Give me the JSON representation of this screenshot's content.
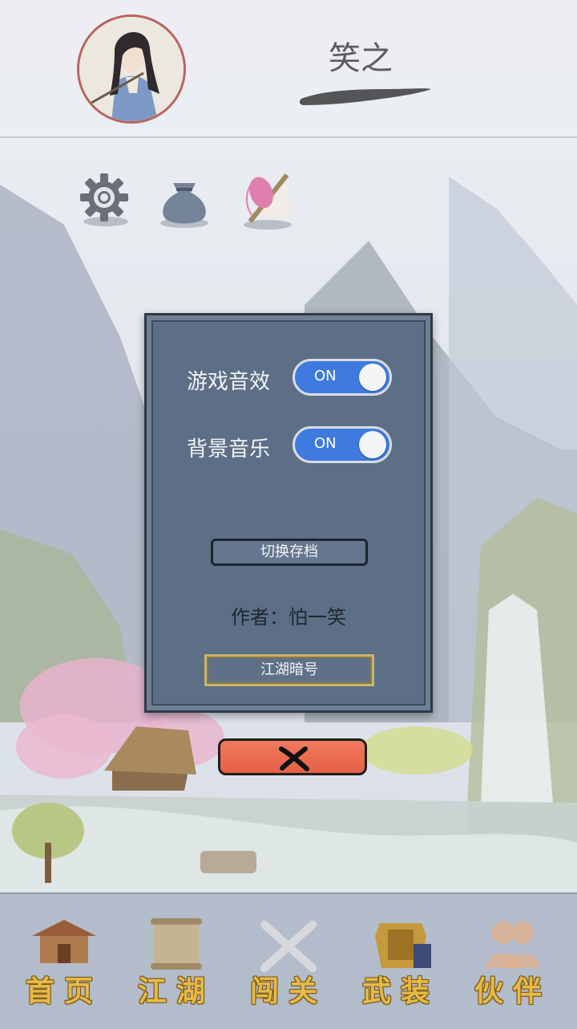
{
  "profile": {
    "name": "笑之"
  },
  "toolbar": {
    "settings_icon": "gear-icon",
    "bag_icon": "pouch-icon",
    "token_icon": "token-tag-icon"
  },
  "settings": {
    "sound_label": "游戏音效",
    "sound_state": "ON",
    "music_label": "背景音乐",
    "music_state": "ON",
    "switch_save": "切换存档",
    "author": "作者：怕一笑",
    "secret": "江湖暗号",
    "close_icon": "close-x-icon"
  },
  "nav": {
    "items": [
      {
        "label": "首页",
        "icon": "house-icon"
      },
      {
        "label": "江湖",
        "icon": "scroll-icon"
      },
      {
        "label": "闯关",
        "icon": "crossed-swords-icon"
      },
      {
        "label": "武装",
        "icon": "armor-icon"
      },
      {
        "label": "伙伴",
        "icon": "companions-icon"
      }
    ]
  },
  "colors": {
    "toggle_on": "#3f7ae0",
    "dialog_bg": "#5d6f86",
    "close_btn": "#e46046",
    "nav_text": "#e7b94a"
  }
}
